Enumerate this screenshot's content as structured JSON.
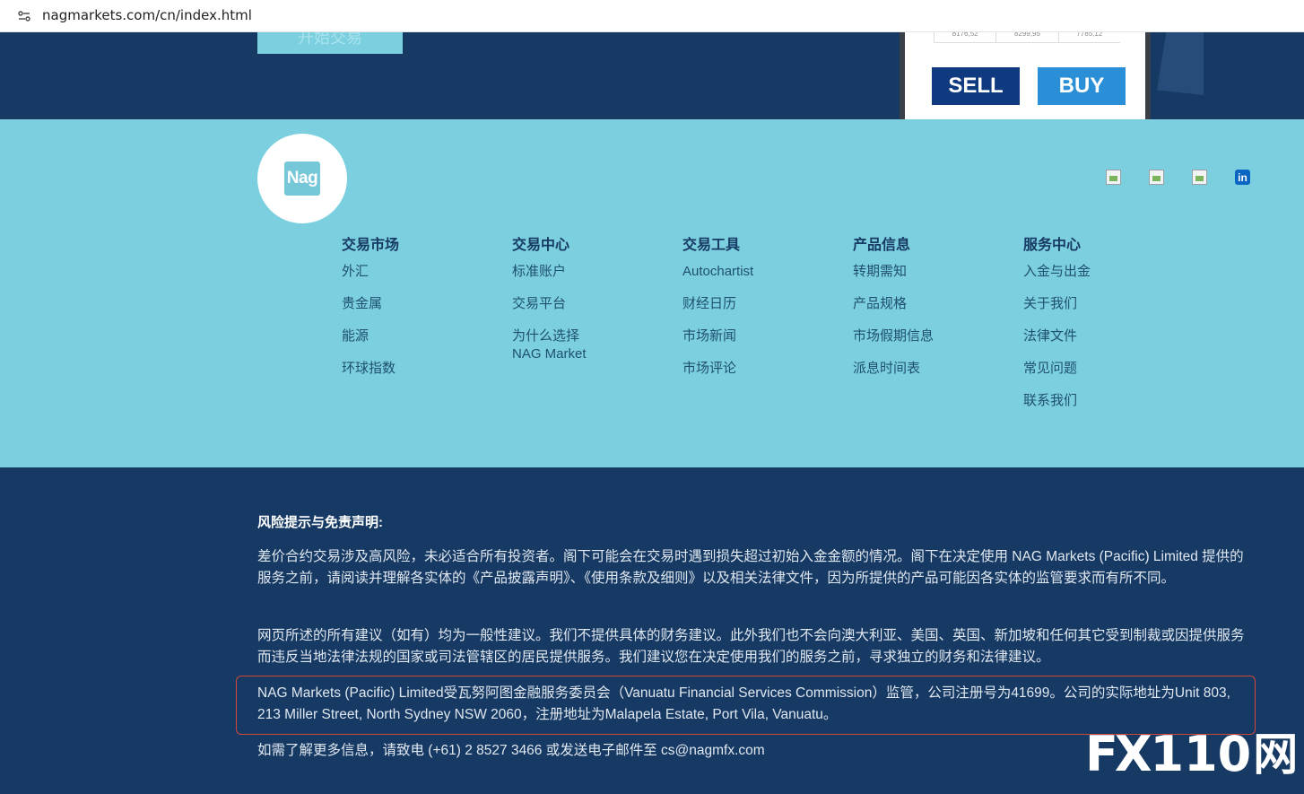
{
  "browser": {
    "url": "nagmarkets.com/cn/index.html"
  },
  "hero": {
    "cta_label": "开始交易",
    "prices": [
      "8176,52",
      "8299,95",
      "7785,12"
    ],
    "sell_label": "SELL",
    "buy_label": "BUY"
  },
  "logo": {
    "text": "Nag"
  },
  "socials": [
    {
      "name": "social-icon-1"
    },
    {
      "name": "social-icon-2"
    },
    {
      "name": "social-icon-3"
    },
    {
      "name": "linkedin-icon",
      "text": "in"
    }
  ],
  "nav": {
    "columns": [
      {
        "title": "交易市场",
        "items": [
          "外汇",
          "贵金属",
          "能源",
          "环球指数"
        ]
      },
      {
        "title": "交易中心",
        "items": [
          "标准账户",
          "交易平台",
          "为什么选择\nNAG Market"
        ]
      },
      {
        "title": "交易工具",
        "items": [
          "Autochartist",
          "财经日历",
          "市场新闻",
          "市场评论"
        ]
      },
      {
        "title": "产品信息",
        "items": [
          "转期需知",
          "产品规格",
          "市场假期信息",
          "派息时间表"
        ]
      },
      {
        "title": "服务中心",
        "items": [
          "入金与出金",
          "关于我们",
          "法律文件",
          "常见问题",
          "联系我们"
        ]
      }
    ]
  },
  "disclaimer": {
    "title": "风险提示与免责声明:",
    "p1": "差价合约交易涉及高风险，未必适合所有投资者。阁下可能会在交易时遇到损失超过初始入金金额的情况。阁下在决定使用 NAG Markets (Pacific) Limited 提供的服务之前，请阅读并理解各实体的《产品披露声明》、《使用条款及细则》以及相关法律文件，因为所提供的产品可能因各实体的监管要求而有所不同。",
    "p2": "网页所述的所有建议（如有）均为一般性建议。我们不提供具体的财务建议。此外我们也不会向澳大利亚、美国、英国、新加坡和任何其它受到制裁或因提供服务而违反当地法律法规的国家或司法管辖区的居民提供服务。我们建议您在决定使用我们的服务之前，寻求独立的财务和法律建议。",
    "p3": "NAG Markets (Pacific) Limited受瓦努阿图金融服务委员会（Vanuatu Financial Services Commission）监管，公司注册号为41699。公司的实际地址为Unit 803, 213 Miller Street, North Sydney NSW 2060，注册地址为Malapela Estate, Port Vila, Vanuatu。",
    "p4": "如需了解更多信息，请致电 (+61) 2 8527 3466 或发送电子邮件至 cs@nagmfx.com"
  },
  "watermark": {
    "fx": "FX",
    "num": "110",
    "han": "网"
  },
  "colors": {
    "navy": "#163a64",
    "teal": "#7bcfde",
    "sell": "#0f3a80",
    "buy": "#2a8fd6",
    "highlight": "#d2463a"
  }
}
